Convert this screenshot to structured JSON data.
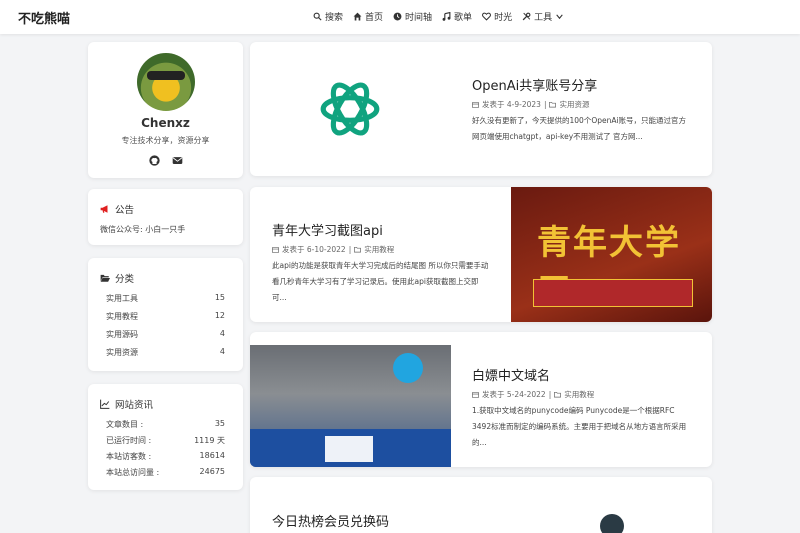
{
  "nav": {
    "brand": "不吃熊喵",
    "items": [
      {
        "label": "搜索",
        "icon": "search-icon"
      },
      {
        "label": "首页",
        "icon": "home-icon"
      },
      {
        "label": "时间轴",
        "icon": "clock-icon"
      },
      {
        "label": "歌单",
        "icon": "music-icon"
      },
      {
        "label": "时光",
        "icon": "heart-icon"
      },
      {
        "label": "工具",
        "icon": "tools-icon"
      }
    ]
  },
  "profile": {
    "name": "Chenxz",
    "desc": "专注技术分享，资源分享"
  },
  "notice": {
    "title": "公告",
    "text": "微信公众号: 小白一只手"
  },
  "categories": {
    "title": "分类",
    "items": [
      {
        "name": "实用工具",
        "count": "15"
      },
      {
        "name": "实用教程",
        "count": "12"
      },
      {
        "name": "实用源码",
        "count": "4"
      },
      {
        "name": "实用资源",
        "count": "4"
      }
    ]
  },
  "site_info": {
    "title": "网站资讯",
    "items": [
      {
        "name": "文章数目 :",
        "value": "35"
      },
      {
        "name": "已运行时间 :",
        "value": "1119 天"
      },
      {
        "name": "本站访客数 :",
        "value": "18614"
      },
      {
        "name": "本站总访问量 :",
        "value": "24675"
      }
    ]
  },
  "posts": [
    {
      "title": "OpenAi共享账号分享",
      "date": "发表于 4-9-2023",
      "category": "实用资源",
      "excerpt": "好久没有更新了，今天提供的100个OpenAi账号，只能通过官方网页端使用chatgpt，api-key不用测试了 官方网..."
    },
    {
      "title": "青年大学习截图api",
      "date": "发表于 6-10-2022",
      "category": "实用教程",
      "excerpt": "此api的功能是获取青年大学习完成后的结尾图 所以你只需要手动看几秒青年大学习有了学习记录后。使用此api获取截图上交即可..."
    },
    {
      "title": "白嫖中文域名",
      "date": "发表于 5-24-2022",
      "category": "实用教程",
      "excerpt": "1.获取中文域名的punycode编码 Punycode是一个根据RFC 3492标准而制定的编码系统。主要用于把域名从地方语言所采用的..."
    },
    {
      "title": "今日热榜会员兑换码"
    }
  ],
  "cover_text": {
    "big": "青年大学习"
  },
  "colors": {
    "accent_red": "#e02020",
    "openai_green": "#10a37f"
  }
}
